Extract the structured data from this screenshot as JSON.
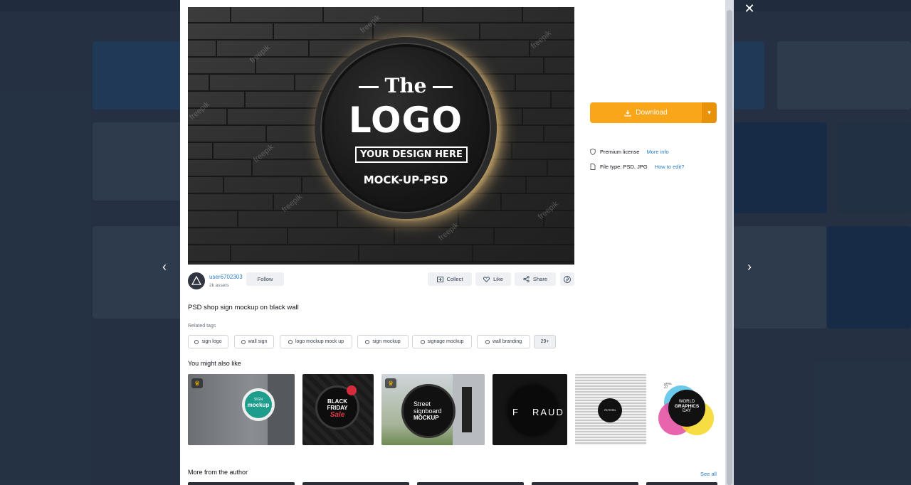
{
  "modal": {
    "close_symbol": "✕",
    "prev_symbol": "‹",
    "next_symbol": "›"
  },
  "preview": {
    "sign": {
      "line1": "The",
      "line2": "LOGO",
      "line3": "YOUR DESIGN HERE",
      "line4": "MOCK-UP-PSD"
    },
    "watermark": "freepik"
  },
  "download": {
    "label": "Download",
    "icon": "download-icon",
    "dropdown_symbol": "▾"
  },
  "license": {
    "text": "Premium license",
    "link": "More info",
    "icon": "shield-icon"
  },
  "filetype": {
    "text": "File type: PSD, JPG",
    "link": "How to edit?",
    "icon": "file-icon"
  },
  "author": {
    "name": "user6702303",
    "assets": "2k assets",
    "follow": "Follow"
  },
  "actions": {
    "collect": "Collect",
    "like": "Like",
    "share": "Share"
  },
  "title": "PSD shop sign mockup on black wall",
  "related": {
    "label": "Related tags",
    "tags": [
      "sign logo",
      "wall sign",
      "logo mockup mock up",
      "sign mockup",
      "signage mockup",
      "wall branding"
    ],
    "more": "29+"
  },
  "you_might_like": {
    "label": "You might also like",
    "thumbs": [
      {
        "t1": "SIGN",
        "t2": "mockup"
      },
      {
        "t1": "BLACK",
        "t2": "FRIDAY",
        "t3": "Sale"
      },
      {
        "t1": "Street",
        "t2": "signboard",
        "t3": "MOCKUP"
      },
      {
        "t1": "F",
        "t2": "RAUD"
      },
      {
        "t1": "PATTERN"
      },
      {
        "t1": "APRIL",
        "t2": "27",
        "t3": "WORLD",
        "t4": "GRAPHICS",
        "t5": "DAY"
      }
    ]
  },
  "more_from_author": {
    "label": "More from the author",
    "see_all": "See all"
  },
  "colors": {
    "accent": "#f9a61a",
    "link": "#2a7ec7"
  }
}
